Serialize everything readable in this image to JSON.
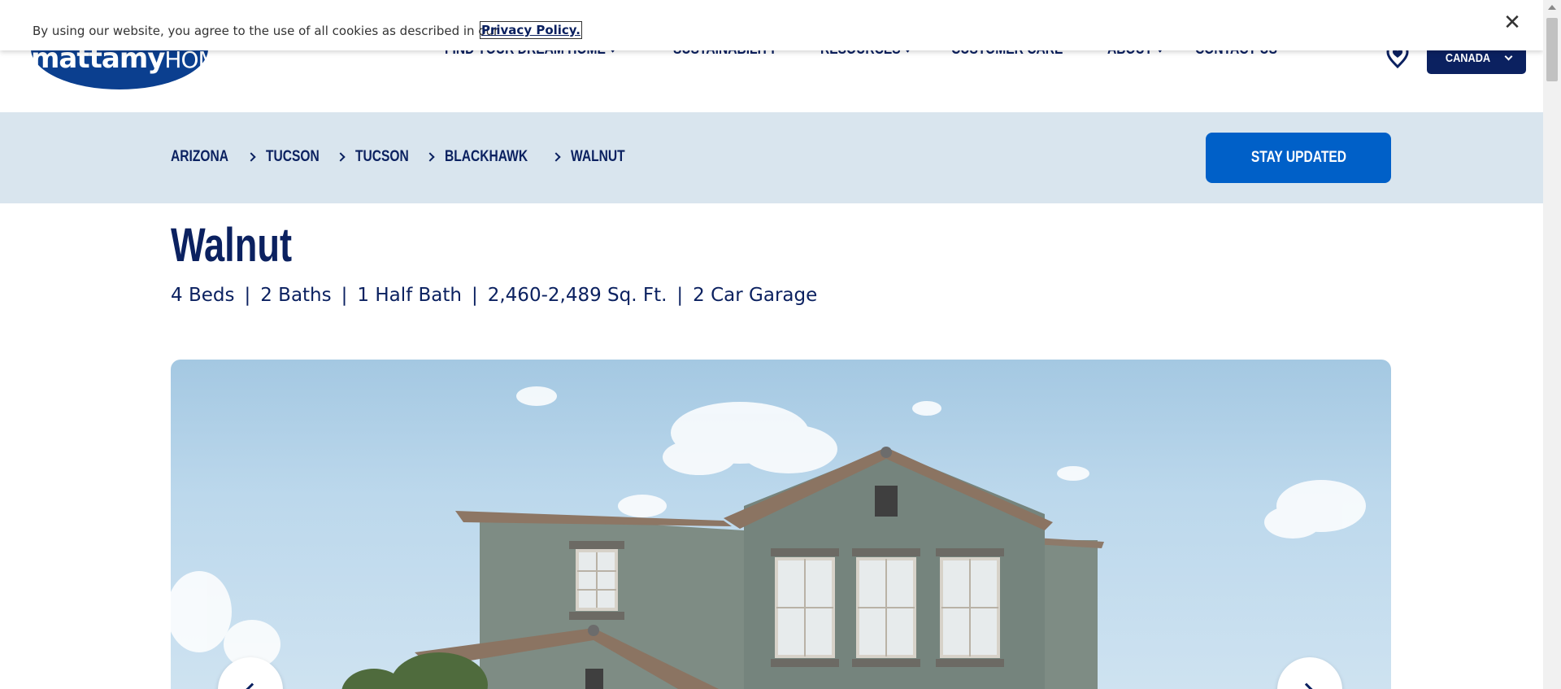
{
  "cookie_banner": {
    "text": "By using our website, you agree to the use of all cookies as described in our",
    "link": "Privacy Policy.",
    "close_glyph": "✕"
  },
  "header": {
    "logo_bold": "mattamy",
    "logo_thin": "HOMES",
    "nav": [
      {
        "label": "FIND YOUR DREAM HOME",
        "has_dropdown": true
      },
      {
        "label": "SUSTAINABILITY",
        "has_dropdown": false
      },
      {
        "label": "RESOURCES",
        "has_dropdown": true
      },
      {
        "label": "CUSTOMER CARE",
        "has_dropdown": false
      },
      {
        "label": "ABOUT",
        "has_dropdown": true
      },
      {
        "label": "CONTACT US",
        "has_dropdown": false
      }
    ],
    "favorites_icon": "heart-location-icon",
    "country": "CANADA"
  },
  "breadcrumb": [
    "ARIZONA",
    "TUCSON",
    "TUCSON",
    "BLACKHAWK",
    "WALNUT"
  ],
  "stay_updated": "STAY UPDATED",
  "home": {
    "title": "Walnut",
    "specs": [
      "4 Beds",
      "2 Baths",
      "1 Half Bath",
      "2,460-2,489 Sq. Ft.",
      "2 Car Garage"
    ],
    "spec_separator": "|"
  },
  "colors": {
    "navy": "#0b2160",
    "accent_blue": "#0060c8",
    "crumb_bg": "#d9e5ee"
  }
}
